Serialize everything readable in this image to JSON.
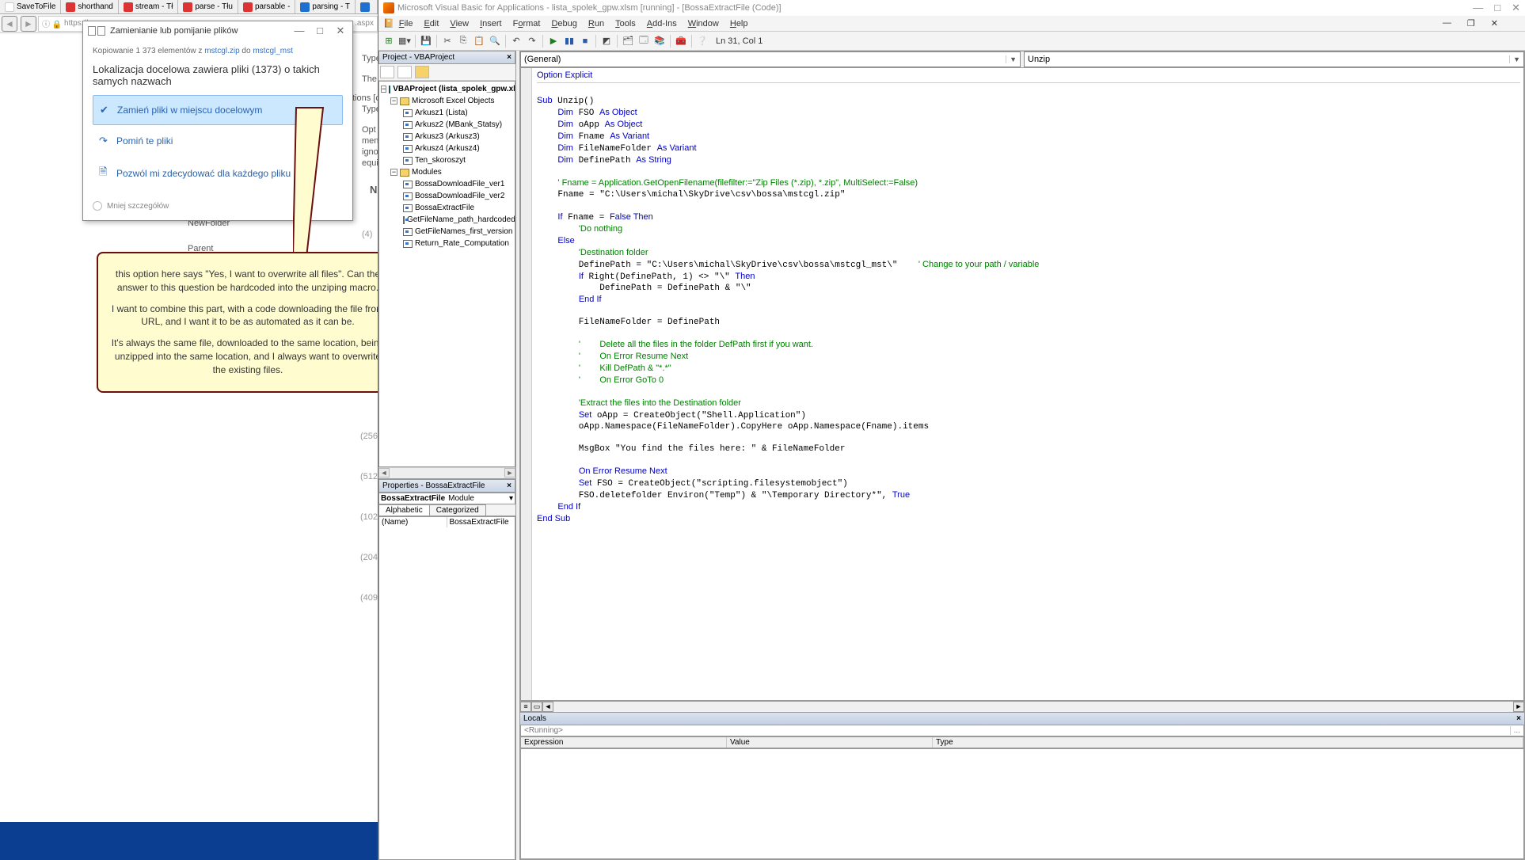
{
  "browser": {
    "tabs": [
      {
        "icon": "blank",
        "label": "SaveToFile"
      },
      {
        "icon": "red",
        "label": "shorthand"
      },
      {
        "icon": "red",
        "label": "stream - Tł"
      },
      {
        "icon": "red",
        "label": "parse - Tłu"
      },
      {
        "icon": "red",
        "label": "parsable -"
      },
      {
        "icon": "ie",
        "label": "parsing - T"
      },
      {
        "icon": "ie",
        "label": ""
      }
    ],
    "url_prefix": "https://",
    "url_suffix": ".aspx"
  },
  "dialog": {
    "title": "Zamienianie lub pomijanie plików",
    "copy_prefix": "Kopiowanie 1 373 elementów z ",
    "copy_link1": "mstcgl.zip",
    "copy_mid": " do ",
    "copy_link2": "mstcgl_mst",
    "conflict": "Lokalizacja docelowa zawiera pliki (1373) o takich samych nazwach",
    "opt_replace": "Zamień pliki w miejscu docelowym",
    "opt_skip": "Pomiń te pliki",
    "opt_decide": "Pozwól mi zdecydować dla każdego pliku",
    "more": "Mniej szczegółów"
  },
  "callout": {
    "p1": "this option here says \"Yes, I want to overwrite all files\". Can the answer to this question be hardcoded into the unziping macro.",
    "p2": "I want to combine this part, with a code downloading the file from URL, and I want it to be as automated as it can be.",
    "p3": "It's always the same file, downloaded to the same location, being unzipped into the same location, and I always want to overwrite the existing files."
  },
  "bg": {
    "type1": "Type",
    "the": "The",
    "tions": "tions [c",
    "type2": "Type",
    "opt": "Opt",
    "mem": "men",
    "igno": "igno",
    "equ": "equi",
    "n": "N",
    "newfolder": "NewFolder",
    "four": "(4)",
    "parent": "Parent",
    "n256": "(256",
    "n512": "(512",
    "n102": "(102",
    "n204": "(204",
    "n409": "(409"
  },
  "vba": {
    "title": "Microsoft Visual Basic for Applications - lista_spolek_gpw.xlsm [running] - [BossaExtractFile (Code)]",
    "menus": [
      "File",
      "Edit",
      "View",
      "Insert",
      "Format",
      "Debug",
      "Run",
      "Tools",
      "Add-Ins",
      "Window",
      "Help"
    ],
    "pos": "Ln 31, Col 1",
    "dd_left": "(General)",
    "dd_right": "Unzip",
    "proj_title": "Project - VBAProject",
    "props_title": "Properties - BossaExtractFile",
    "props_obj_name": "BossaExtractFile",
    "props_obj_type": "Module",
    "props_tab1": "Alphabetic",
    "props_tab2": "Categorized",
    "props_name_key": "(Name)",
    "props_name_val": "BossaExtractFile",
    "locals_title": "Locals",
    "locals_running": "<Running>",
    "locals_cols": [
      "Expression",
      "Value",
      "Type"
    ],
    "tree": {
      "root": "VBAProject (lista_spolek_gpw.xls",
      "excel_objects": "Microsoft Excel Objects",
      "sheets": [
        "Arkusz1 (Lista)",
        "Arkusz2 (MBank_Statsy)",
        "Arkusz3 (Arkusz3)",
        "Arkusz4 (Arkusz4)",
        "Ten_skoroszyt"
      ],
      "modules_label": "Modules",
      "modules": [
        "BossaDownloadFile_ver1",
        "BossaDownloadFile_ver2",
        "BossaExtractFile",
        "GetFileName_path_hardcoded",
        "GetFileNames_first_version",
        "Return_Rate_Computation"
      ]
    }
  }
}
